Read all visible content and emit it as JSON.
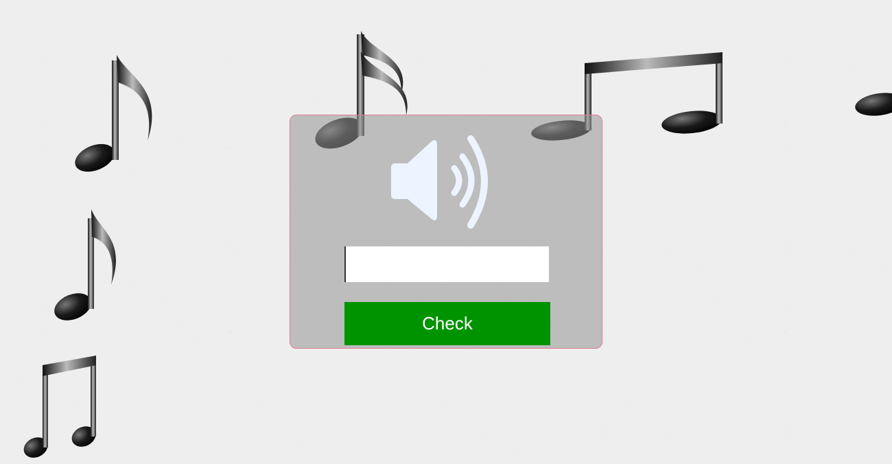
{
  "captcha": {
    "type": "audio",
    "play_icon": "speaker-volume-icon",
    "answer_value": "",
    "answer_placeholder": "",
    "check_label": "Check"
  },
  "colors": {
    "panel_border": "#e07a90",
    "check_button": "#009300",
    "check_text": "#ffffff",
    "speaker_icon": "#eef4ff"
  },
  "decorations": {
    "music_note_icons": [
      "eighth-note-icon",
      "sixteenth-note-icon",
      "beamed-eighth-notes-icon"
    ]
  }
}
